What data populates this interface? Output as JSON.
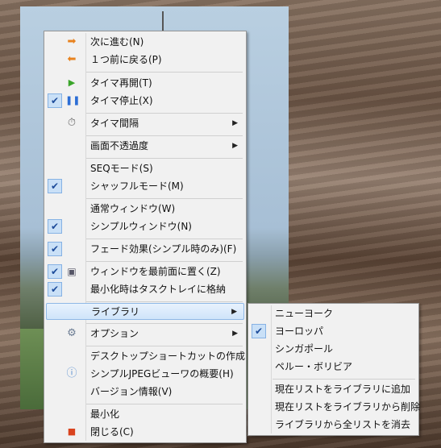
{
  "main_menu": {
    "next": "次に進む(N)",
    "prev": "１つ前に戻る(P)",
    "timer_resume": "タイマ再開(T)",
    "timer_stop": "タイマ停止(X)",
    "timer_interval": "タイマ間隔",
    "opacity": "画面不透過度",
    "seq_mode": "SEQモード(S)",
    "shuffle_mode": "シャッフルモード(M)",
    "normal_window": "通常ウィンドウ(W)",
    "simple_window": "シンプルウィンドウ(N)",
    "fade": "フェード効果(シンプル時のみ)(F)",
    "topmost": "ウィンドウを最前面に置く(Z)",
    "tray": "最小化時はタスクトレイに格納",
    "library": "ライブラリ",
    "options": "オプション",
    "shortcut": "デスクトップショートカットの作成",
    "about": "シンプルJPEGビューワの概要(H)",
    "version": "バージョン情報(V)",
    "minimize": "最小化",
    "close": "閉じる(C)"
  },
  "sub_menu": {
    "newyork": "ニューヨーク",
    "europe": "ヨーロッパ",
    "singapore": "シンガポール",
    "peru": "ペルー・ボリビア",
    "add": "現在リストをライブラリに追加",
    "remove": "現在リストをライブラリから削除",
    "clear": "ライブラリから全リストを消去"
  },
  "glyphs": {
    "check": "✔",
    "submenu_arrow": "▶"
  },
  "colors": {
    "highlight": "#cfe4fa",
    "arrow_orange": "#e8821e",
    "play_green": "#3aa52a",
    "close_red": "#d9431e"
  }
}
